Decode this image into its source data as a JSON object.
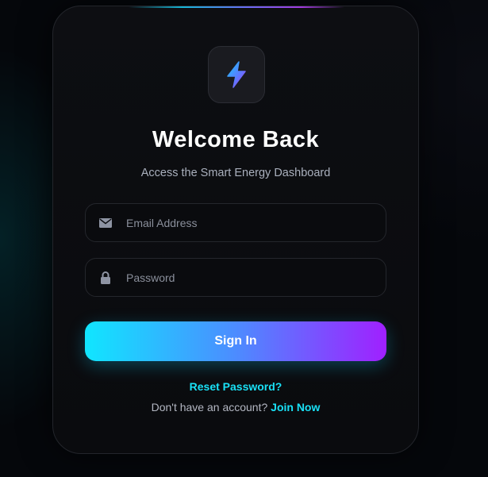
{
  "brand": {
    "logo_icon": "lightning-bolt-icon",
    "accent_start": "#10e6ff",
    "accent_end": "#a020ff"
  },
  "header": {
    "title": "Welcome Back",
    "subtitle": "Access the Smart Energy Dashboard"
  },
  "form": {
    "email": {
      "placeholder": "Email Address",
      "value": "",
      "icon": "envelope-icon"
    },
    "password": {
      "placeholder": "Password",
      "value": "",
      "icon": "lock-icon"
    },
    "submit_label": "Sign In"
  },
  "footer": {
    "reset_label": "Reset Password?",
    "signup_prompt": "Don't have an account?",
    "signup_link": "Join Now"
  }
}
